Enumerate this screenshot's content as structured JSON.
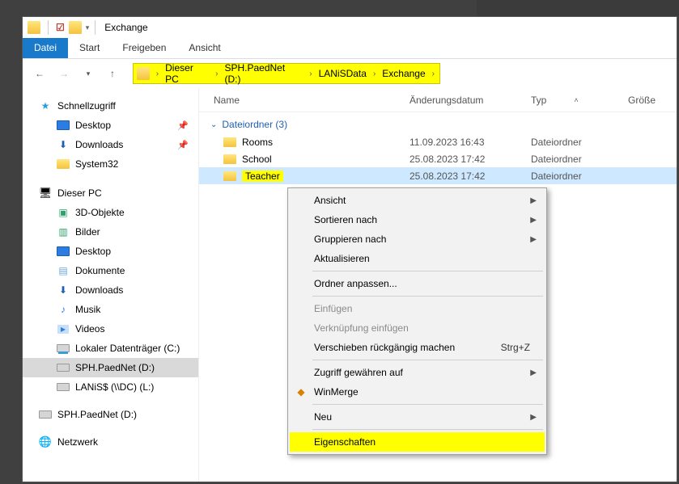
{
  "window": {
    "title": "Exchange"
  },
  "ribbon": {
    "file": "Datei",
    "start": "Start",
    "share": "Freigeben",
    "view": "Ansicht"
  },
  "breadcrumb": [
    "Dieser PC",
    "SPH.PaedNet (D:)",
    "LANiSData",
    "Exchange"
  ],
  "tree": {
    "quick": "Schnellzugriff",
    "desktop": "Desktop",
    "downloads": "Downloads",
    "system32": "System32",
    "thispc": "Dieser PC",
    "obj3d": "3D-Objekte",
    "bilder": "Bilder",
    "desktop2": "Desktop",
    "dokumente": "Dokumente",
    "downloads2": "Downloads",
    "musik": "Musik",
    "videos": "Videos",
    "driveC": "Lokaler Datenträger (C:)",
    "driveD": "SPH.PaedNet (D:)",
    "driveL": "LANiS$ (\\\\DC) (L:)",
    "driveD2": "SPH.PaedNet (D:)",
    "network": "Netzwerk"
  },
  "columns": {
    "name": "Name",
    "mod": "Änderungsdatum",
    "type": "Typ",
    "size": "Größe"
  },
  "group": {
    "label": "Dateiordner (3)"
  },
  "rows": [
    {
      "name": "Rooms",
      "date": "11.09.2023 16:43",
      "type": "Dateiordner"
    },
    {
      "name": "School",
      "date": "25.08.2023 17:42",
      "type": "Dateiordner"
    },
    {
      "name": "Teacher",
      "date": "25.08.2023 17:42",
      "type": "Dateiordner"
    }
  ],
  "context": {
    "ansicht": "Ansicht",
    "sortieren": "Sortieren nach",
    "gruppieren": "Gruppieren nach",
    "aktualisieren": "Aktualisieren",
    "anpassen": "Ordner anpassen...",
    "einfuegen": "Einfügen",
    "verknuepfung": "Verknüpfung einfügen",
    "undo": "Verschieben rückgängig machen",
    "undo_short": "Strg+Z",
    "zugriff": "Zugriff gewähren auf",
    "winmerge": "WinMerge",
    "neu": "Neu",
    "eigenschaften": "Eigenschaften"
  }
}
